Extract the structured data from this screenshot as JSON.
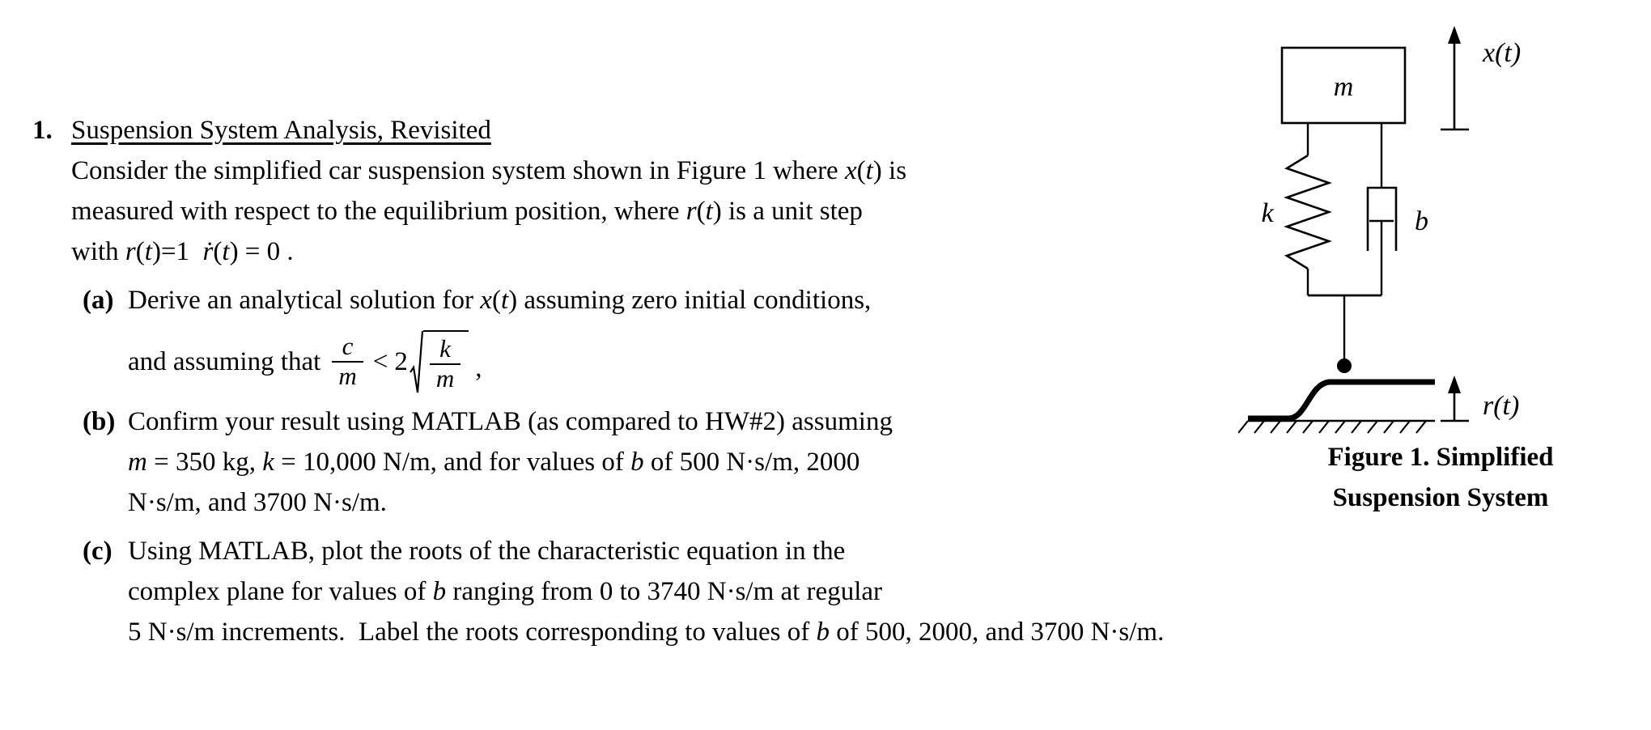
{
  "document": {
    "problem_number": "1.",
    "title": "Suspension System Analysis, Revisited",
    "intro_line1": "Consider the simplified car suspension system shown in Figure 1 where x(t) is",
    "intro_line2": "measured with respect to the equilibrium position, where r(t) is a unit step",
    "intro_line3_prefix": "with ",
    "intro_line3_math": "r(t)=1  ṙ(t) = 0",
    "intro_line3_suffix": ".",
    "parts": [
      {
        "label": "(a)",
        "line1": "Derive an analytical solution for x(t) assuming zero initial conditions,",
        "line2_lead": "and assuming that",
        "math": {
          "fraction_numerator": "c",
          "fraction_denominator": "m",
          "relation": "<",
          "coefficient": "2",
          "radicand_numerator": "k",
          "radicand_denominator": "m",
          "trailing": ","
        }
      },
      {
        "label": "(b)",
        "line1": "Confirm your result using MATLAB (as compared to HW#2) assuming",
        "line2": "m = 350 kg, k = 10,000 N/m, and for values of b of 500 N·s/m, 2000",
        "line3": "N·s/m, and 3700 N·s/m."
      },
      {
        "label": "(c)",
        "line1": "Using MATLAB, plot the roots of the characteristic equation in the",
        "line2": "complex plane for values of b ranging from 0 to 3740 N·s/m at regular",
        "line3": "5 N·s/m increments.  Label the roots corresponding to values of b of 500, 2000, and 3700 N·s/m."
      }
    ]
  },
  "figure": {
    "mass_label": "m",
    "spring_label": "k",
    "damper_label": "b",
    "output_label": "x(t)",
    "input_label": "r(t)",
    "caption_line1": "Figure 1.  Simplified",
    "caption_line2": "Suspension System"
  },
  "colors": {
    "ink": "#000000",
    "paper": "#ffffff"
  }
}
